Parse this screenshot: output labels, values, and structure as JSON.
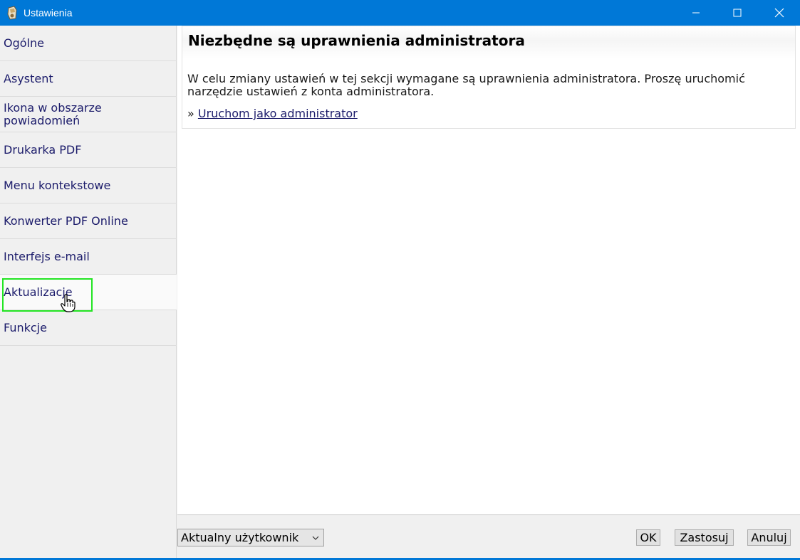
{
  "window": {
    "title": "Ustawienia",
    "accent_color": "#0078d7",
    "controls": [
      "minimize-icon",
      "maximize-icon",
      "close-icon"
    ]
  },
  "sidebar": {
    "items": [
      {
        "label": "Ogólne"
      },
      {
        "label": "Asystent"
      },
      {
        "label": "Ikona w obszarze powiadomień"
      },
      {
        "label": "Drukarka PDF"
      },
      {
        "label": "Menu kontekstowe"
      },
      {
        "label": "Konwerter PDF Online"
      },
      {
        "label": "Interfejs e-mail"
      },
      {
        "label": "Aktualizacje"
      },
      {
        "label": "Funkcje"
      }
    ],
    "active_item": "Aktualizacje",
    "highlight_color": "#23e523"
  },
  "main": {
    "notice_title": "Niezbędne są uprawnienia administratora",
    "notice_text": "W celu zmiany ustawień w tej sekcji wymagane są uprawnienia administratora. Proszę uruchomić narzędzie ustawień z konta administratora.",
    "link_prefix": "»",
    "link_label": "Uruchom jako administrator"
  },
  "footer": {
    "scope_select_value": "Aktualny użytkownik",
    "ok_label": "OK",
    "apply_label": "Zastosuj",
    "cancel_label": "Anuluj"
  }
}
